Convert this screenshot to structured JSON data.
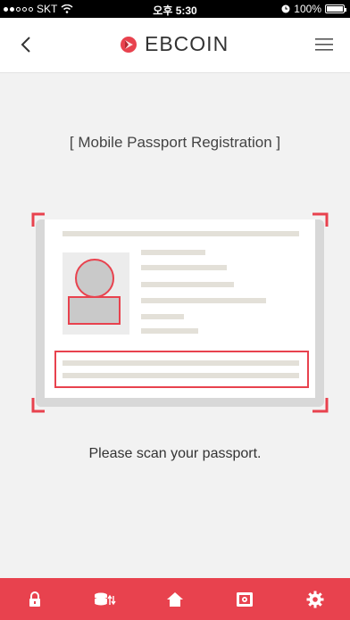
{
  "status_bar": {
    "carrier": "SKT",
    "time": "오후 5:30",
    "battery": "100%"
  },
  "header": {
    "logo_text": "EBCOIN"
  },
  "main": {
    "title": "[ Mobile Passport Registration ]",
    "instruction": "Please scan your passport."
  },
  "tab_bar": {
    "items": [
      {
        "icon": "lock-icon"
      },
      {
        "icon": "coins-transfer-icon"
      },
      {
        "icon": "home-icon"
      },
      {
        "icon": "safe-icon"
      },
      {
        "icon": "gear-icon"
      }
    ]
  },
  "colors": {
    "accent": "#e8424e",
    "background": "#f2f2f2"
  }
}
